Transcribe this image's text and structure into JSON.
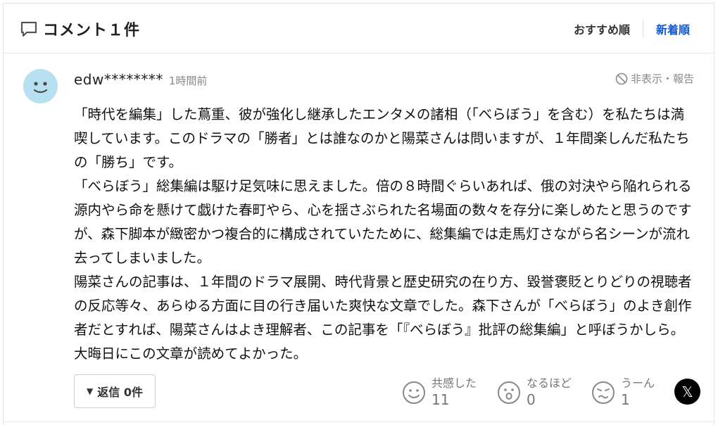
{
  "header": {
    "title": "コメント１件",
    "sort_recommended": "おすすめ順",
    "sort_newest": "新着順"
  },
  "comment": {
    "username": "edw********",
    "timestamp": "1時間前",
    "report_label": "非表示・報告",
    "paragraphs": [
      "「時代を編集」した蔦重、彼が強化し継承したエンタメの諸相（「べらぼう」を含む）を私たちは満喫しています。このドラマの「勝者」とは誰なのかと陽菜さんは問いますが、１年間楽しんだ私たちの「勝ち」です。",
      "「べらぼう」総集編は駆け足気味に思えました。倍の８時間ぐらいあれば、俄の対決やら陥れられる源内やら命を懸けて戯けた春町やら、心を揺さぶられた名場面の数々を存分に楽しめたと思うのですが、森下脚本が緻密かつ複合的に構成されていたために、総集編では走馬灯さながら名シーンが流れ去ってしまいました。",
      "陽菜さんの記事は、１年間のドラマ展開、時代背景と歴史研究の在り方、毀誉褒貶とりどりの視聴者の反応等々、あらゆる方面に目の行き届いた爽快な文章でした。森下さんが「べらぼう」のよき創作者だとすれば、陽菜さんはよき理解者、この記事を「『べらぼう』批評の総集編」と呼ぼうかしら。大晦日にこの文章が読めてよかった。"
    ],
    "reply_label": "返信 0件",
    "reactions": [
      {
        "label": "共感した",
        "count": "11",
        "icon": "smile-face-icon"
      },
      {
        "label": "なるほど",
        "count": "0",
        "icon": "surprised-face-icon"
      },
      {
        "label": "うーん",
        "count": "1",
        "icon": "puzzled-face-icon"
      }
    ],
    "share_label": "𝕏"
  },
  "colors": {
    "accent": "#1558c9",
    "avatar": "#b7e1f1",
    "muted": "#777777"
  }
}
